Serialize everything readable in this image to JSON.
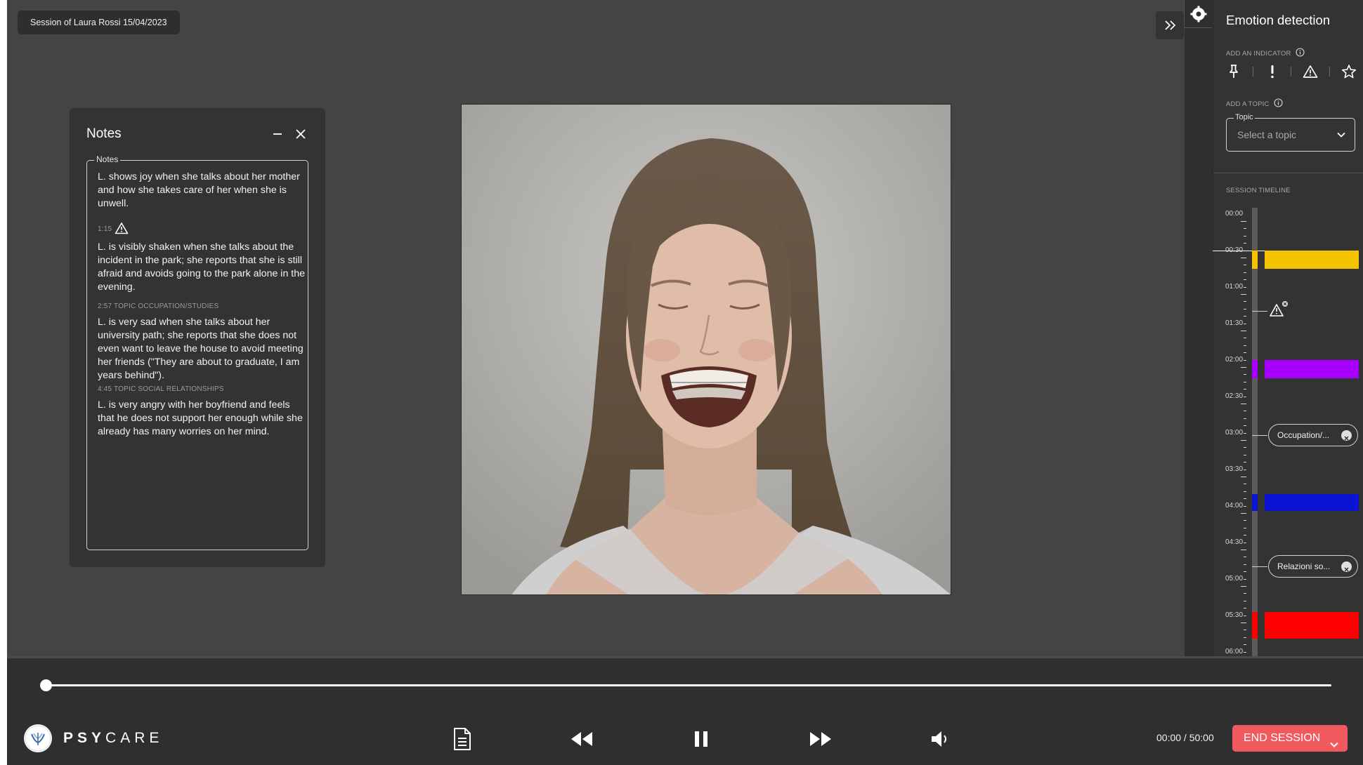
{
  "session": {
    "label": "Session of Laura Rossi 15/04/2023"
  },
  "notes": {
    "title": "Notes",
    "field_label": "Notes",
    "entries": [
      {
        "meta": "",
        "text": "L. shows joy when she talks about her mother and how she takes care of her when she is unwell."
      },
      {
        "meta": "1:15",
        "icon": "warning-icon",
        "text": "L. is visibly shaken when she talks about the incident in the park; she reports that she is still afraid and avoids going to the park alone in the evening."
      },
      {
        "meta": "2:57 TOPIC OCCUPATION/STUDIES",
        "text": "L. is very sad when she talks about her university path; she reports that she does not even want to leave the house to avoid meeting her friends (\"They are about to graduate, I am years behind\")."
      },
      {
        "meta": "4:45 TOPIC SOCIAL RELATIONSHIPS",
        "text": "L. is very angry with her boyfriend and feels that he does not support her enough while she already has many worries on her mind."
      }
    ]
  },
  "side_panel": {
    "title": "Emotion detection",
    "add_indicator_label": "ADD AN INDICATOR",
    "indicators": [
      "pin-icon",
      "exclamation-icon",
      "warning-icon",
      "star-icon"
    ],
    "add_topic_label": "ADD A TOPIC",
    "topic_field_label": "Topic",
    "topic_placeholder": "Select a topic",
    "timeline_label": "SESSION TIMELINE",
    "timeline_marks": [
      "00:00",
      "00:30",
      "01:00",
      "01:30",
      "02:00",
      "02:30",
      "03:00",
      "03:30",
      "04:00",
      "04:30",
      "05:00",
      "05:30",
      "06:00"
    ],
    "emotion_bars": [
      {
        "color": "#f5c400",
        "start": "00:30",
        "end": "00:38"
      },
      {
        "color": "#a800ff",
        "start": "02:00",
        "end": "02:08"
      },
      {
        "color": "#0a14d2",
        "start": "03:50",
        "end": "03:57"
      },
      {
        "color": "#ff0000",
        "start": "05:27",
        "end": "05:42"
      }
    ],
    "warning_marker": {
      "time": "01:15",
      "icon": "warning-icon"
    },
    "topic_chips": [
      {
        "label": "Occupation/...",
        "time": "02:57"
      },
      {
        "label": "Relazioni so...",
        "time": "04:45"
      }
    ]
  },
  "player": {
    "brand_bold": "PSY",
    "brand_light": "CARE",
    "progress": 0,
    "time_readout": "00:00 / 50:00",
    "end_label": "END SESSION"
  },
  "colors": {
    "end_button": "#f05a5f",
    "background": "#444444",
    "panel": "#333333"
  }
}
